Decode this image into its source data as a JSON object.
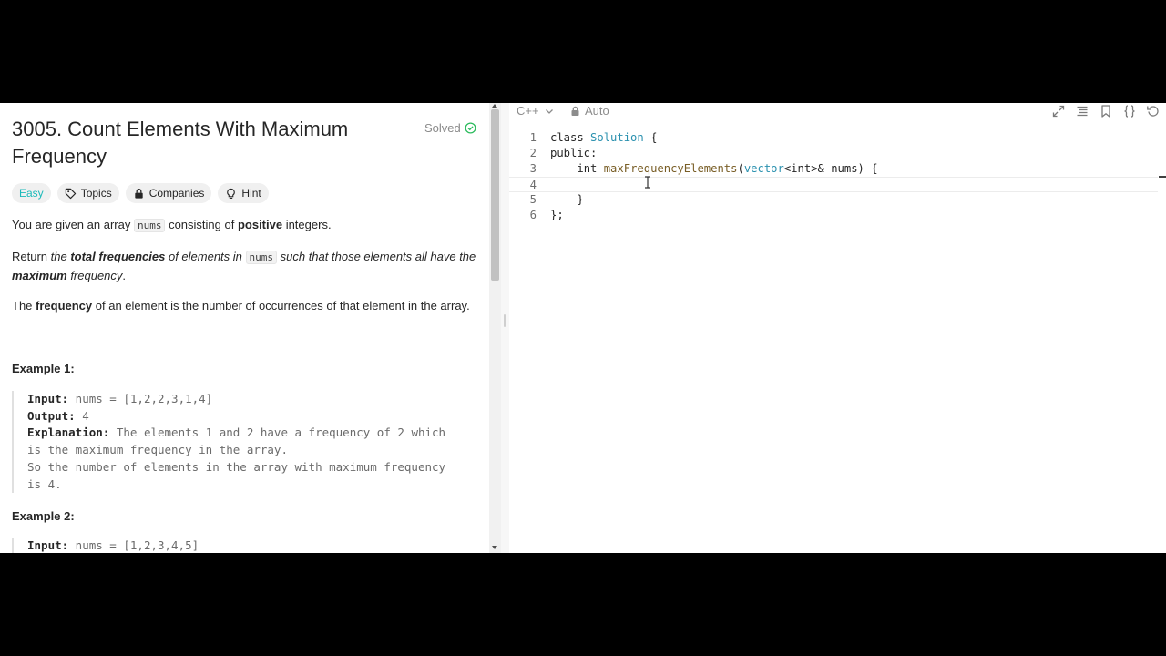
{
  "problem": {
    "title": "3005. Count Elements With Maximum Frequency",
    "status": "Solved",
    "tags": {
      "difficulty": "Easy",
      "topics": "Topics",
      "companies": "Companies",
      "hint": "Hint"
    },
    "p1": {
      "a": "You are given an array ",
      "code": "nums",
      "b": " consisting of ",
      "bold": "positive",
      "c": " integers."
    },
    "p2": {
      "a": "Return ",
      "em1": "the ",
      "bold1": "total frequencies",
      "em2": " of elements in ",
      "code": "nums",
      "em3": " such that those elements all have the ",
      "bold2": "maximum",
      "em4": " frequency",
      "end": "."
    },
    "p3": {
      "a": "The ",
      "bold": "frequency",
      "b": " of an element is the number of occurrences of that element in the array."
    },
    "example1": {
      "heading": "Example 1:",
      "input_label": "Input:",
      "input_value": " nums = [1,2,2,3,1,4]",
      "output_label": "Output:",
      "output_value": " 4",
      "explanation_label": "Explanation:",
      "explanation_l1": " The elements 1 and 2 have a frequency of 2 which",
      "explanation_l2": "is the maximum frequency in the array.",
      "explanation_l3": "So the number of elements in the array with maximum frequency",
      "explanation_l4": "is 4."
    },
    "example2": {
      "heading": "Example 2:",
      "input_label": "Input:",
      "input_value": " nums = [1,2,3,4,5]"
    }
  },
  "editor": {
    "language": "C++",
    "mode": "Auto",
    "lines": [
      {
        "n": "1"
      },
      {
        "n": "2"
      },
      {
        "n": "3"
      },
      {
        "n": "4"
      },
      {
        "n": "5"
      },
      {
        "n": "6"
      }
    ],
    "code": {
      "l1_kw": "class ",
      "l1_ty": "Solution",
      "l1_end": " {",
      "l2": "public:",
      "l3_indent": "    ",
      "l3_kw": "int ",
      "l3_fn": "maxFrequencyElements",
      "l3_p": "(",
      "l3_ty": "vector",
      "l3_t": "<int>& nums) {",
      "l4": "",
      "l5": "    }",
      "l6": "};"
    }
  }
}
